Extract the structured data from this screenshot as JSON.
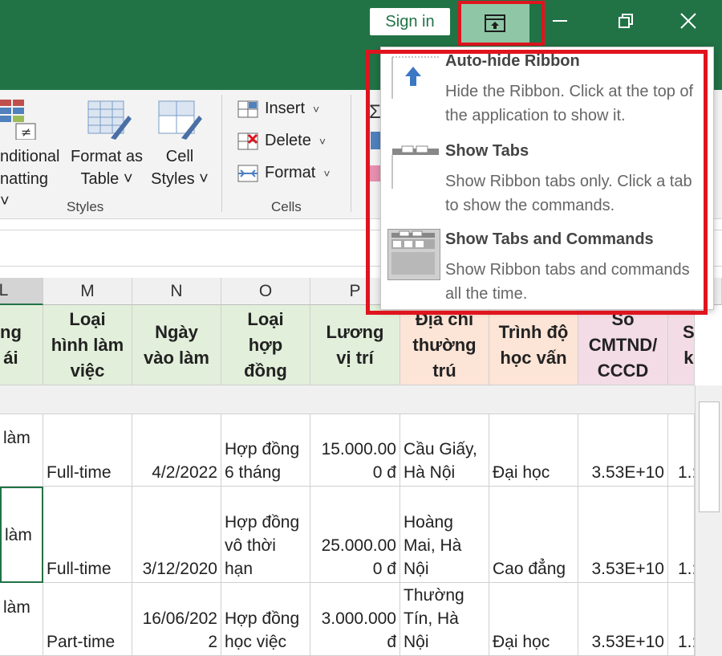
{
  "titlebar": {
    "signin": "Sign in",
    "bg": "#217346"
  },
  "ribbon": {
    "cond_fmt": [
      "nditional",
      "natting ˅"
    ],
    "format_as_table": [
      "Format as",
      "Table ˅"
    ],
    "cell_styles": [
      "Cell",
      "Styles ˅"
    ],
    "styles_group": "Styles",
    "insert": "Insert",
    "delete": "Delete",
    "format": "Format",
    "cells_group": "Cells"
  },
  "menu": {
    "options": [
      {
        "title": "Auto-hide Ribbon",
        "desc": "Hide the Ribbon. Click at the top of the application to show it."
      },
      {
        "title": "Show Tabs",
        "desc": "Show Ribbon tabs only. Click a tab to show the commands."
      },
      {
        "title": "Show Tabs and Commands",
        "desc": "Show Ribbon tabs and commands all the time."
      }
    ]
  },
  "columns": [
    "L",
    "M",
    "N",
    "O",
    "P"
  ],
  "headers": {
    "L": [
      "ng",
      "ái"
    ],
    "M": [
      "Loại",
      "hình làm",
      "việc"
    ],
    "N": [
      "Ngày",
      "vào làm"
    ],
    "O": [
      "Loại",
      "hợp",
      "đồng"
    ],
    "P": [
      "Lương",
      "vị trí"
    ],
    "Q": [
      "Địa chỉ",
      "thường",
      "trú"
    ],
    "R": [
      "Trình độ",
      "học vấn"
    ],
    "S": [
      "Số",
      "CMTND/",
      "CCCD"
    ],
    "T": [
      "S",
      "k"
    ]
  },
  "rows": [
    {
      "L": "làm",
      "M": "Full-time",
      "N": "4/2/2022",
      "O": [
        "Hợp đồng",
        "6 tháng"
      ],
      "P": [
        "15.000.00",
        "0 đ"
      ],
      "Q": [
        "Cầu Giấy,",
        "Hà Nội"
      ],
      "R": "Đại học",
      "S": "3.53E+10",
      "T": "1.:"
    },
    {
      "L": "làm",
      "M": "Full-time",
      "N": "3/12/2020",
      "O": [
        "Hợp đồng",
        "vô thời",
        "hạn"
      ],
      "P": [
        "25.000.00",
        "0 đ"
      ],
      "Q": [
        "Hoàng",
        "Mai, Hà",
        "Nội"
      ],
      "R": "Cao đẳng",
      "S": "3.53E+10",
      "T": "1.:"
    },
    {
      "L": "làm",
      "M": "Part-time",
      "N": [
        "16/06/202",
        "2"
      ],
      "O": [
        "Hợp đồng",
        "học việc"
      ],
      "P": [
        "3.000.000",
        "đ"
      ],
      "Q": [
        "Thường",
        "Tín, Hà",
        "Nội"
      ],
      "R": "Đại học",
      "S": "3.53E+10",
      "T": "1.:"
    }
  ],
  "colors": {
    "green_header": "#e2efda",
    "orange_header": "#fce4d6",
    "pink_header": "#f3dce6",
    "highlight": "#e0141e"
  }
}
